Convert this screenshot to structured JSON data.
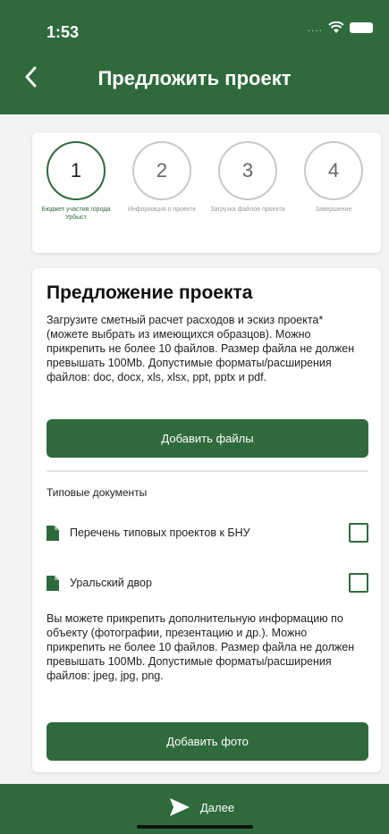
{
  "status_bar": {
    "time": "1:53",
    "signal": "...."
  },
  "header": {
    "title": "Предложить проект"
  },
  "steps": [
    {
      "number": "1",
      "label": "Бюджет участия города Урбыст"
    },
    {
      "number": "2",
      "label": "Информация о проекте"
    },
    {
      "number": "3",
      "label": "Загрузка файлов проекта"
    },
    {
      "number": "4",
      "label": "Завершение"
    }
  ],
  "proposal": {
    "title": "Предложение проекта",
    "description": "Загрузите сметный расчет расходов и эскиз проекта* (можете выбрать из имеющихся образцов). Можно прикрепить не более 10 файлов. Размер файла не должен превышать 100Mb. Допустимые форматы/расширения файлов: doc, docx, xls, xlsx, ppt, pptx и pdf.",
    "add_files_label": "Добавить файлы",
    "typical_docs_label": "Типовые документы",
    "documents": [
      {
        "label": "Перечень типовых проектов к БНУ",
        "checked": false
      },
      {
        "label": "Уральский двор",
        "checked": false
      }
    ],
    "photo_description": "Вы можете прикрепить дополнительную информацию по объекту (фотографии, презентацию и др.). Можно прикрепить не более 10 файлов. Размер файла не должен превышать 100Mb. Допустимые форматы/расширения файлов: jpeg, jpg, png.",
    "add_photo_label": "Добавить фото"
  },
  "footer": {
    "next_label": "Далее"
  },
  "colors": {
    "primary": "#2f6a3c",
    "background": "#f3f3f3",
    "card": "#ffffff"
  }
}
